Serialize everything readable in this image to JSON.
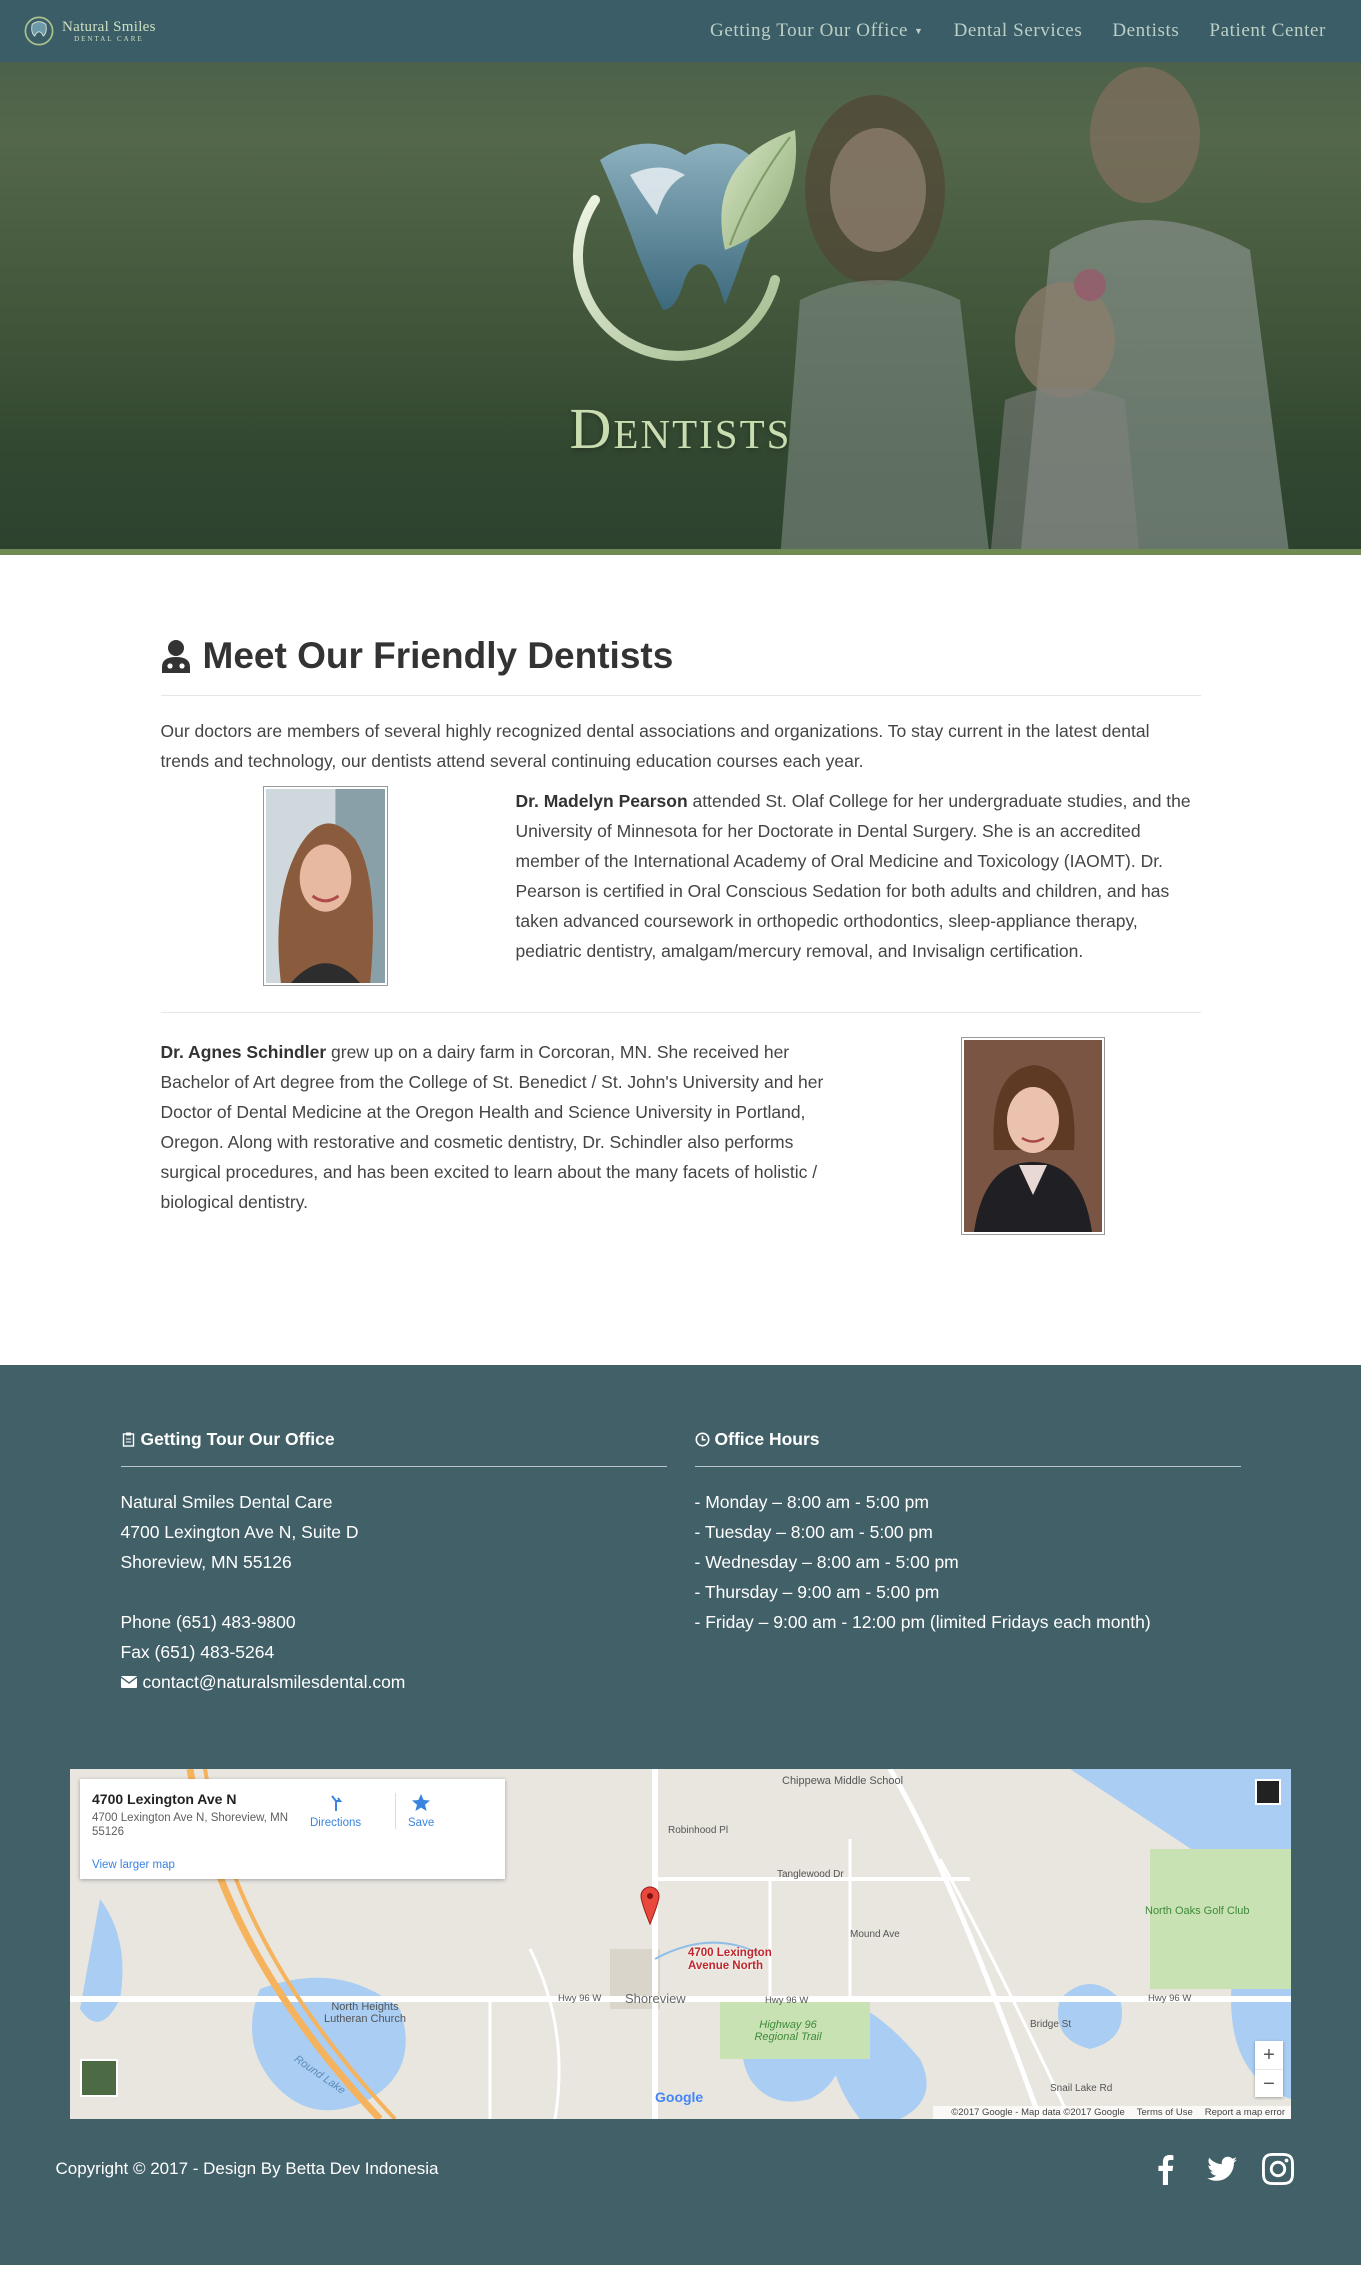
{
  "brand": {
    "name": "Natural Smiles",
    "sub": "DENTAL CARE"
  },
  "nav": {
    "items": [
      {
        "label": "Getting Tour Our Office",
        "dropdown": true
      },
      {
        "label": "Dental Services"
      },
      {
        "label": "Dentists"
      },
      {
        "label": "Patient Center"
      }
    ]
  },
  "hero": {
    "title": "Dentists"
  },
  "main": {
    "title": "Meet Our Friendly Dentists",
    "intro": "Our doctors are members of several highly recognized dental associations and organizations. To stay current in the latest dental trends and technology, our dentists attend several continuing education courses each year.",
    "doctors": [
      {
        "name": "Dr. Madelyn Pearson",
        "bio": " attended St. Olaf College for her undergraduate studies, and the University of Minnesota for her Doctorate in Dental Surgery. She is an accredited member of the International Academy of Oral Medicine and Toxicology (IAOMT). Dr. Pearson is certified in Oral Conscious Sedation for both adults and children, and has taken advanced coursework in orthopedic orthodontics, sleep-appliance therapy, pediatric dentistry, amalgam/mercury removal, and Invisalign certification."
      },
      {
        "name": "Dr. Agnes Schindler",
        "bio": " grew up on a dairy farm in Corcoran, MN. She received her Bachelor of Art degree from the College of St. Benedict / St. John's University and her Doctor of Dental Medicine at the Oregon Health and Science University in Portland, Oregon. Along with restorative and cosmetic dentistry, Dr. Schindler also performs surgical procedures, and has been excited to learn about the many facets of holistic / biological dentistry."
      }
    ]
  },
  "footer": {
    "office": {
      "heading": "Getting Tour Our Office",
      "name": "Natural Smiles Dental Care",
      "street": "4700 Lexington Ave N, Suite D",
      "city": "Shoreview, MN 55126",
      "phone": "Phone (651) 483-9800",
      "fax": "Fax (651) 483-5264",
      "email": "contact@naturalsmilesdental.com"
    },
    "hours": {
      "heading": "Office Hours",
      "lines": [
        "- Monday – 8:00 am - 5:00 pm",
        "- Tuesday – 8:00 am - 5:00 pm",
        "- Wednesday – 8:00 am - 5:00 pm",
        "- Thursday – 9:00 am - 5:00 pm",
        "- Friday – 9:00 am - 12:00 pm (limited Fridays each month)"
      ]
    },
    "map": {
      "card_title": "4700 Lexington Ave N",
      "card_address": "4700 Lexington Ave N, Shoreview, MN 55126",
      "directions": "Directions",
      "save": "Save",
      "larger": "View larger map",
      "pin_label": "4700 Lexington Avenue North",
      "labels": {
        "chippewa": "Chippewa Middle School",
        "golf": "North Oaks Golf Club",
        "shoreview": "Shoreview",
        "hwy96": "Hwy 96 W",
        "north_heights": "North Heights Lutheran Church",
        "regional_trail": "Highway 96 Regional Trail",
        "round_lake": "Round Lake",
        "tanglewood": "Tanglewood Dr",
        "mound": "Mound Ave",
        "robinhood": "Robinhood Pl",
        "snail_lake": "Snail Lake Rd",
        "bridge": "Bridge St"
      },
      "google": "Google",
      "attrib": "©2017 Google - Map data ©2017 Google",
      "terms": "Terms of Use",
      "report": "Report a map error",
      "zoom_in": "+",
      "zoom_out": "−"
    },
    "copyright": "Copyright © 2017 - Design By Betta Dev Indonesia",
    "social": [
      "facebook-icon",
      "twitter-icon",
      "instagram-icon"
    ]
  }
}
